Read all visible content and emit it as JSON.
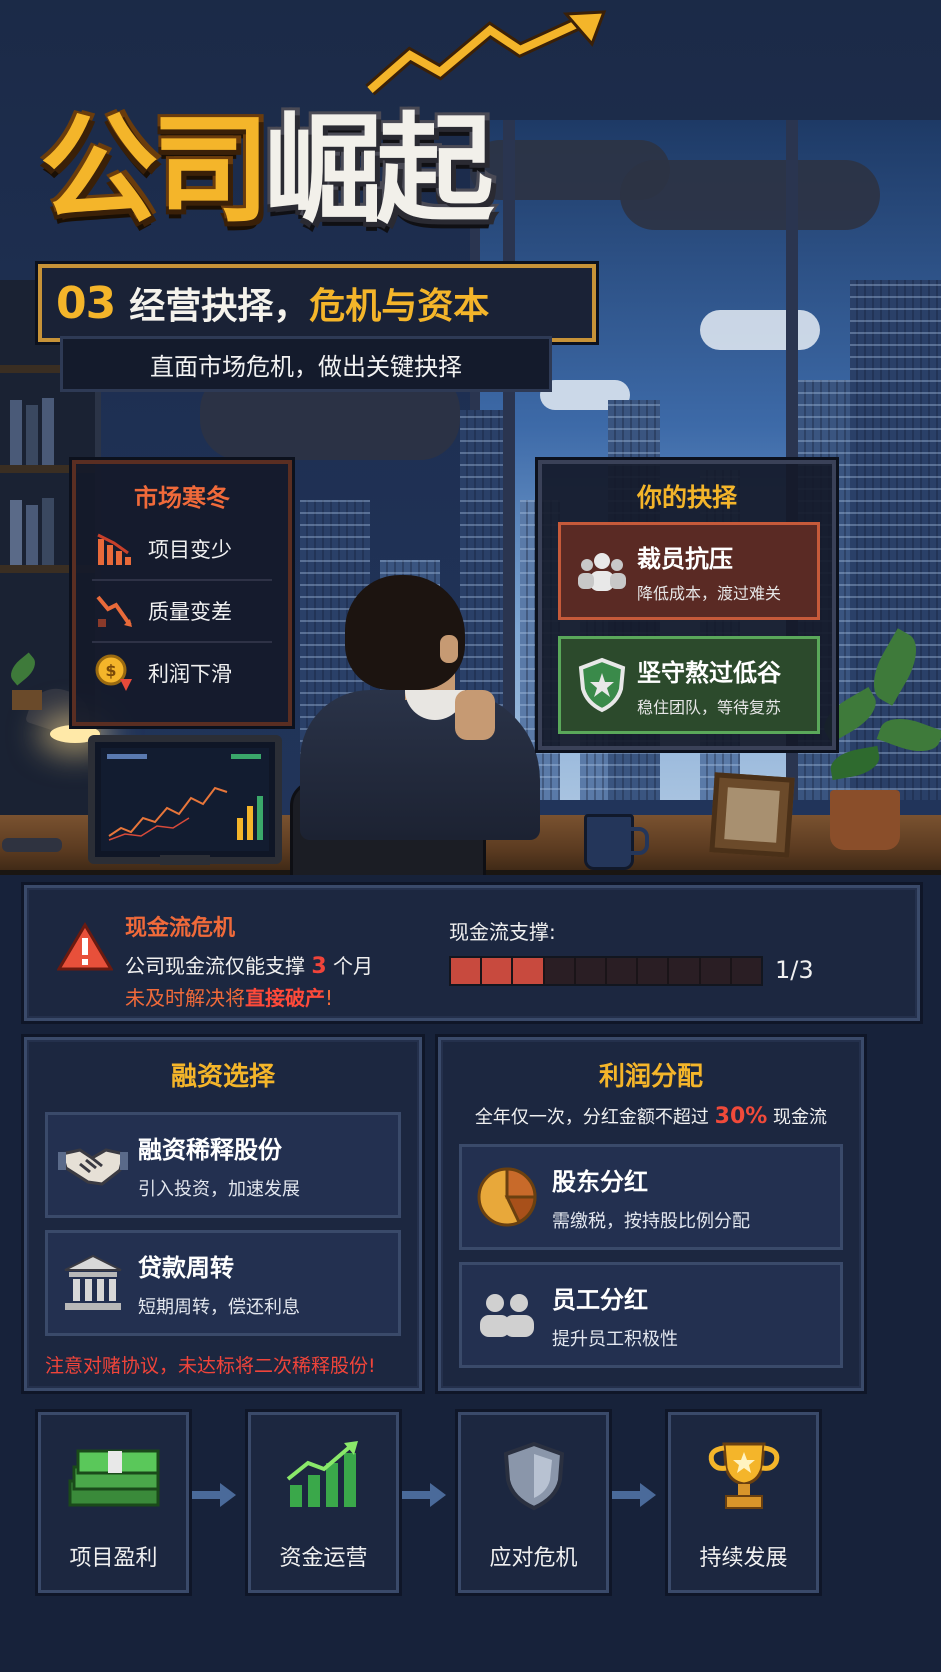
{
  "title": {
    "part1": "公司",
    "part2": "崛起"
  },
  "chapter": {
    "number": "03",
    "text": "经营抉择，",
    "highlight": "危机与资本",
    "subtitle": "直面市场危机，做出关键抉择"
  },
  "market": {
    "title": "市场寒冬",
    "items": [
      {
        "label": "项目变少",
        "icon": "declining-bars-icon"
      },
      {
        "label": "质量变差",
        "icon": "broken-chart-icon"
      },
      {
        "label": "利润下滑",
        "icon": "coin-down-icon"
      }
    ]
  },
  "choice": {
    "title": "你的抉择",
    "options": [
      {
        "title": "裁员抗压",
        "desc": "降低成本，渡过难关",
        "icon": "people-icon",
        "color": "#5a2a24"
      },
      {
        "title": "坚守熬过低谷",
        "desc": "稳住团队，等待复苏",
        "icon": "shield-icon",
        "color": "#2c4a2c"
      }
    ]
  },
  "cashflow": {
    "title": "现金流危机",
    "line1_before": "公司现金流仅能支撑 ",
    "months": "3",
    "line1_after": " 个月",
    "line2_before": "未及时解决将",
    "line2_emph": "直接破产",
    "line2_after": "!",
    "support_label": "现金流支撑:",
    "fraction": "1/3",
    "support_level": 0.3333
  },
  "financing": {
    "title": "融资选择",
    "options": [
      {
        "title": "融资稀释股份",
        "desc": "引入投资，加速发展",
        "icon": "handshake-icon"
      },
      {
        "title": "贷款周转",
        "desc": "短期周转，偿还利息",
        "icon": "bank-icon"
      }
    ],
    "note": "注意对赌协议，未达标将二次稀释股份!"
  },
  "profit": {
    "title": "利润分配",
    "sub_before": "全年仅一次，分红金额不超过 ",
    "sub_pct": "30%",
    "sub_after": " 现金流",
    "options": [
      {
        "title": "股东分红",
        "desc": "需缴税，按持股比例分配",
        "icon": "pie-chart-icon"
      },
      {
        "title": "员工分红",
        "desc": "提升员工积极性",
        "icon": "team-icon"
      }
    ]
  },
  "flow": [
    {
      "label": "项目盈利",
      "icon": "money-stack-icon"
    },
    {
      "label": "资金运营",
      "icon": "growth-chart-icon"
    },
    {
      "label": "应对危机",
      "icon": "shield-icon"
    },
    {
      "label": "持续发展",
      "icon": "trophy-icon"
    }
  ],
  "colors": {
    "gold": "#f4b52a",
    "danger": "#f0443a",
    "orange": "#f06a3a",
    "panel": "#1c2740"
  }
}
